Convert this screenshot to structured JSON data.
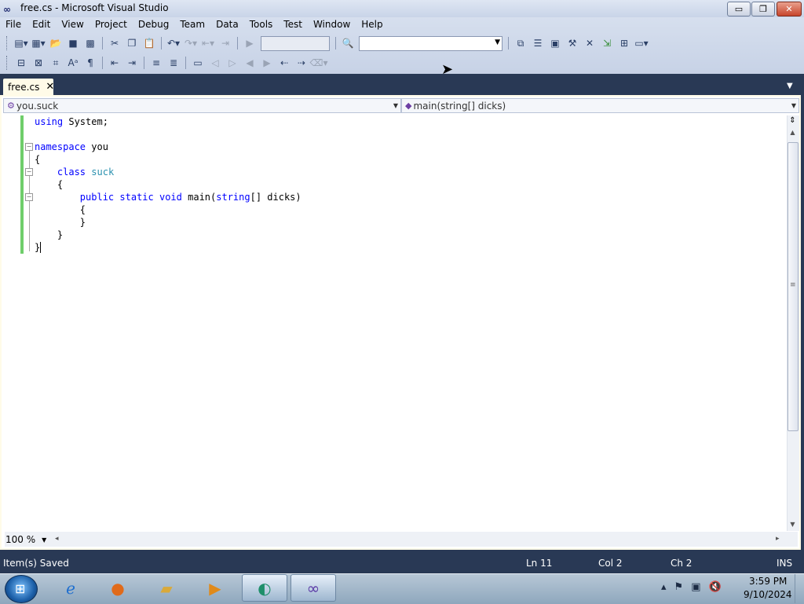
{
  "window": {
    "title": "free.cs - Microsoft Visual Studio",
    "controls": [
      "▭",
      "❐",
      "✕"
    ]
  },
  "menu": [
    "File",
    "Edit",
    "View",
    "Project",
    "Debug",
    "Team",
    "Data",
    "Tools",
    "Test",
    "Window",
    "Help"
  ],
  "toolbar1": [
    "new-project",
    "add-item",
    "open",
    "save",
    "save-all",
    "cut",
    "copy",
    "paste",
    "undo",
    "redo",
    "navigate-back",
    "navigate-forward",
    "start-debugging",
    "find-in-files",
    "solution-explorer",
    "properties",
    "object-browser",
    "toolbox",
    "start-page",
    "extension-manager",
    "command-window"
  ],
  "toolbar2": [
    "members",
    "parameter-info",
    "quick-info",
    "word-completion",
    "complete-word",
    "decrease-indent",
    "increase-indent",
    "comment",
    "uncomment",
    "toggle-bookmark",
    "previous-bookmark",
    "next-bookmark",
    "previous-bookmark-folder",
    "next-bookmark-folder",
    "clear-bookmarks"
  ],
  "tab": {
    "label": "free.cs",
    "close": "✕"
  },
  "nav": {
    "type_scope": "you.suck",
    "member_scope": "main(string[] dicks)"
  },
  "code": {
    "lines": [
      [
        {
          "t": "using",
          "k": "kw"
        },
        {
          "t": " System;",
          "k": ""
        }
      ],
      [],
      [
        {
          "t": "namespace",
          "k": "kw"
        },
        {
          "t": " you",
          "k": ""
        }
      ],
      [
        {
          "t": "{",
          "k": ""
        }
      ],
      [
        {
          "t": "    ",
          "k": ""
        },
        {
          "t": "class",
          "k": "kw"
        },
        {
          "t": " ",
          "k": ""
        },
        {
          "t": "suck",
          "k": "ty"
        }
      ],
      [
        {
          "t": "    {",
          "k": ""
        }
      ],
      [
        {
          "t": "        ",
          "k": ""
        },
        {
          "t": "public",
          "k": "kw"
        },
        {
          "t": " ",
          "k": ""
        },
        {
          "t": "static",
          "k": "kw"
        },
        {
          "t": " ",
          "k": ""
        },
        {
          "t": "void",
          "k": "kw"
        },
        {
          "t": " main(",
          "k": ""
        },
        {
          "t": "string",
          "k": "kw"
        },
        {
          "t": "[] dicks)",
          "k": ""
        }
      ],
      [
        {
          "t": "        {",
          "k": ""
        }
      ],
      [
        {
          "t": "        }",
          "k": ""
        }
      ],
      [
        {
          "t": "    }",
          "k": ""
        }
      ],
      [
        {
          "t": "}",
          "k": "caret"
        }
      ]
    ]
  },
  "zoom": "100 %",
  "status": {
    "message": "Item(s) Saved",
    "line": "Ln 11",
    "col": "Col 2",
    "ch": "Ch 2",
    "mode": "INS"
  },
  "taskbar": {
    "apps": [
      "internet-explorer",
      "firefox",
      "file-explorer",
      "media-player",
      "app-green",
      "visual-studio"
    ],
    "time": "3:59 PM",
    "date": "9/10/2024"
  },
  "colors": {
    "chrome_dark": "#293955",
    "editor_tab": "#fffbe8",
    "keyword": "#0000ff",
    "type": "#2b91af",
    "change_bar": "#6fce6b"
  }
}
